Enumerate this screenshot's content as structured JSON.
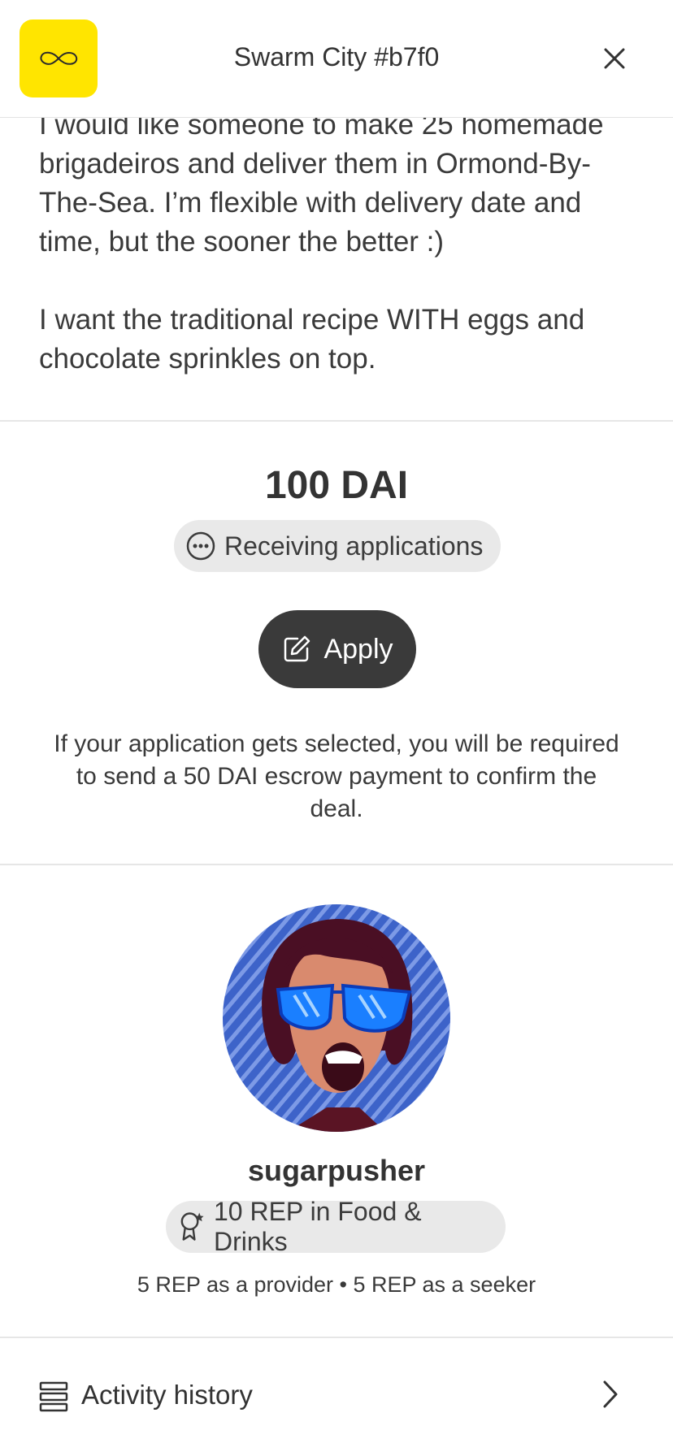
{
  "header": {
    "title": "Swarm City #b7f0",
    "accent_color": "#FFE500",
    "logo_icon": "infinity-icon",
    "close_icon": "close-icon"
  },
  "request": {
    "paragraphs": [
      "I would like someone to make 25 homemade brigadeiros and deliver them in Ormond-By-The-Sea. I’m flexible with delivery date and time, but the sooner the better :)",
      "I want the traditional recipe WITH eggs and chocolate sprinkles on top."
    ]
  },
  "deal": {
    "amount": "100 DAI",
    "status": "Receiving applications",
    "status_icon": "ellipsis-circle-icon",
    "apply_label": "Apply",
    "apply_icon": "edit-icon",
    "escrow_note": "If your application gets selected, you will be required to send a 50 DAI escrow payment to confirm the deal."
  },
  "seeker": {
    "username": "sugarpusher",
    "rep_badge": "10 REP in Food & Drinks",
    "rep_icon": "award-icon",
    "rep_split": "5 REP as a provider • 5 REP as a seeker"
  },
  "activity": {
    "label": "Activity history",
    "icon": "list-icon",
    "chevron": "chevron-right-icon"
  }
}
